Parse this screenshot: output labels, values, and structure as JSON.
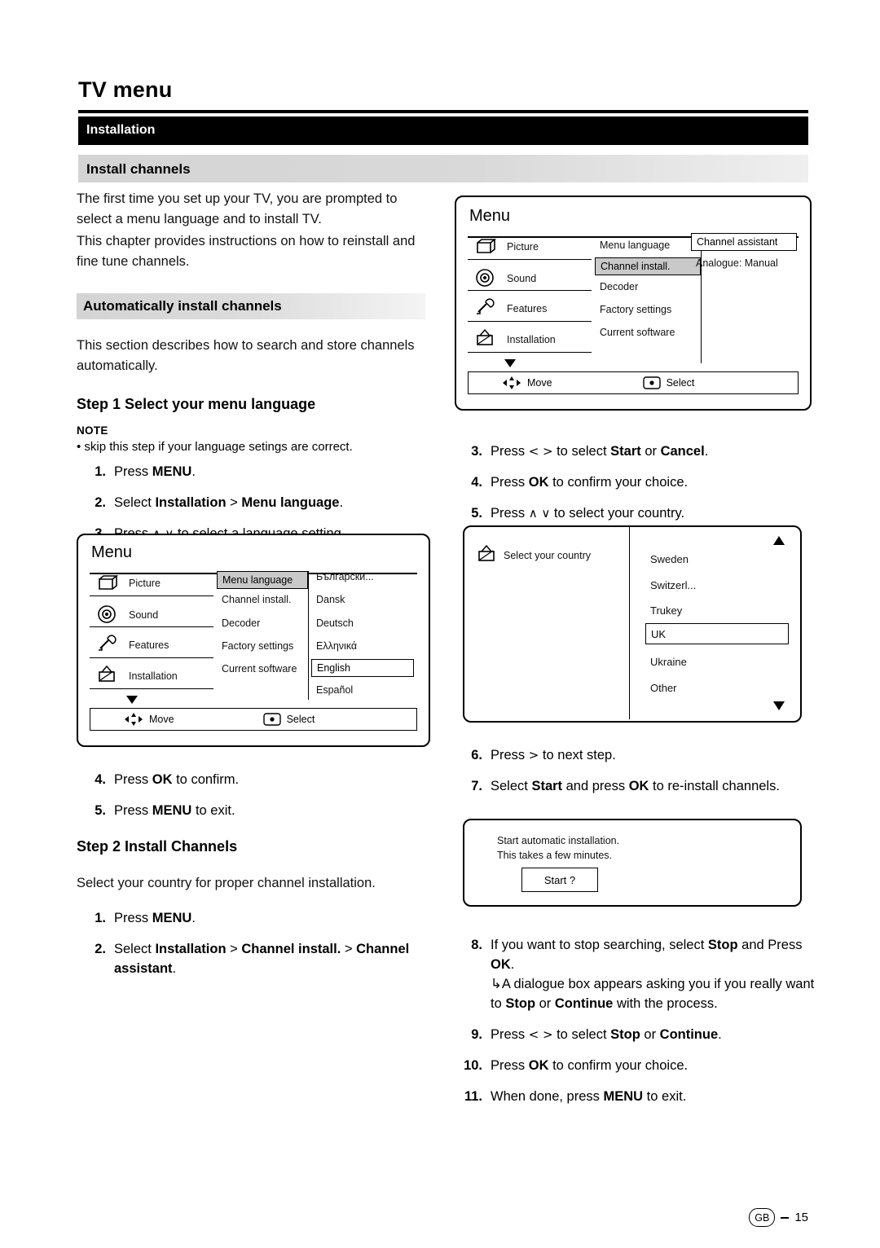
{
  "page": {
    "title": "TV menu",
    "section_bar": "Installation",
    "sub_bar": "Install channels",
    "footer_locale": "GB",
    "footer_page": "15"
  },
  "left": {
    "intro1": "The first time you set up your TV, you are prompted to select a menu language and to install TV.",
    "intro2": "This chapter provides instructions on how to reinstall and fine tune channels.",
    "auto_bar": "Automatically install channels",
    "auto_text": "This section describes how to search and store channels automatically.",
    "step1_heading_num": "Step 1",
    "step1_heading_text": "Select your menu language",
    "note_label": "NOTE",
    "note_text": "•  skip this step if your language setings are correct.",
    "steps_a": [
      {
        "n": "1.",
        "html": "Press <b>MENU</b>."
      },
      {
        "n": "2.",
        "html": "Select <b>Installation</b> &gt; <b>Menu language</b>."
      },
      {
        "n": "3.",
        "html": "Press <span class=\"ar\">∧</span> <span class=\"ar\">∨</span> to select a language setting."
      }
    ],
    "steps_b": [
      {
        "n": "4.",
        "html": "Press <b>OK</b> to confirm."
      },
      {
        "n": "5.",
        "html": "Press <b>MENU</b> to exit."
      }
    ],
    "step2_heading_num": "Step 2",
    "step2_heading_text": "Install Channels",
    "step2_text": "Select your country for proper channel installation.",
    "steps_c": [
      {
        "n": "1.",
        "html": "Press <b>MENU</b>."
      },
      {
        "n": "2.",
        "html": "Select <b>Installation</b> &gt; <b>Channel install.</b> &gt; <b>Channel assistant</b>."
      }
    ]
  },
  "menu_left": {
    "title": "Menu",
    "left_items": [
      "Picture",
      "Sound",
      "Features",
      "Installation"
    ],
    "mid_items": [
      "Menu language",
      "Channel install.",
      "Decoder",
      "Factory settings",
      "Current software"
    ],
    "mid_selected": "Menu language",
    "right_items": [
      "Български...",
      "Dansk",
      "Deutsch",
      "Ελληνικά",
      "English",
      "Español"
    ],
    "right_selected": "English",
    "foot_move": "Move",
    "foot_select": "Select"
  },
  "menu_right": {
    "title": "Menu",
    "left_items": [
      "Picture",
      "Sound",
      "Features",
      "Installation"
    ],
    "mid_items": [
      "Menu language",
      "Channel install.",
      "Decoder",
      "Factory settings",
      "Current software"
    ],
    "mid_selected": "Channel install.",
    "right_items": [
      "Channel assistant",
      "Analogue: Manual"
    ],
    "right_selected": "Channel assistant",
    "foot_move": "Move",
    "foot_select": "Select"
  },
  "country_box": {
    "label": "Select your country",
    "items": [
      "Sweden",
      "Switzerl...",
      "Trukey",
      "UK",
      "Ukraine",
      "Other"
    ],
    "selected": "UK"
  },
  "start_box": {
    "line1": "Start automatic installation.",
    "line2": "This takes a few minutes.",
    "button": "Start ?"
  },
  "right": {
    "steps_top": [
      {
        "n": "3.",
        "html": "Press <span class=\"ar\">&lt;</span> <span class=\"ar\">&gt;</span> to select <b>Start</b> or <b>Cancel</b>."
      },
      {
        "n": "4.",
        "html": "Press <b>OK</b> to confirm your choice."
      },
      {
        "n": "5.",
        "html": "Press <span class=\"ar\">∧</span> <span class=\"ar\">∨</span> to select your country."
      }
    ],
    "steps_mid": [
      {
        "n": "6.",
        "html": "Press <span class=\"ar\">&gt;</span> to next step."
      },
      {
        "n": "7.",
        "html": "Select <b>Start</b> and press <b>OK</b> to re-install channels."
      }
    ],
    "steps_bottom": [
      {
        "n": "8.",
        "html": "If you want to stop searching, select <b>Stop</b> and Press <b>OK</b>.<br><span style=\"font-family:'DejaVu Sans',sans-serif\">↳</span>A dialogue box appears asking you if you really want to <b>Stop</b> or <b>Continue</b> with the process."
      },
      {
        "n": "9.",
        "html": "Press <span class=\"ar\">&lt;</span> <span class=\"ar\">&gt;</span> to select <b>Stop</b> or <b>Continue</b>."
      },
      {
        "n": "10.",
        "html": "Press <b>OK</b> to confirm your choice."
      },
      {
        "n": "11.",
        "html": "When done, press <b>MENU</b> to exit."
      }
    ]
  }
}
